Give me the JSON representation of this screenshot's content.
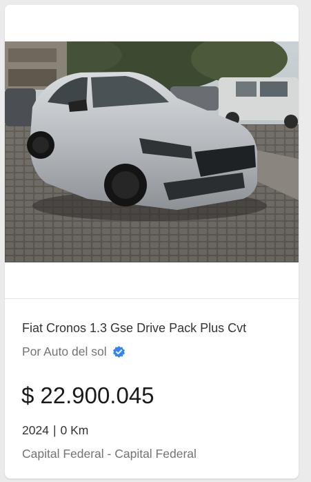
{
  "listing": {
    "title": "Fiat Cronos 1.3 Gse Drive Pack Plus Cvt",
    "seller": "Por Auto del sol",
    "verified_icon": "verified-badge-icon",
    "currency_symbol": "$",
    "price": "22.900.045",
    "year": "2024",
    "separator": "|",
    "mileage": "0 Km",
    "location": "Capital Federal - Capital Federal",
    "verified_color": "#3483fa",
    "image_subject": "silver sedan car photo"
  }
}
